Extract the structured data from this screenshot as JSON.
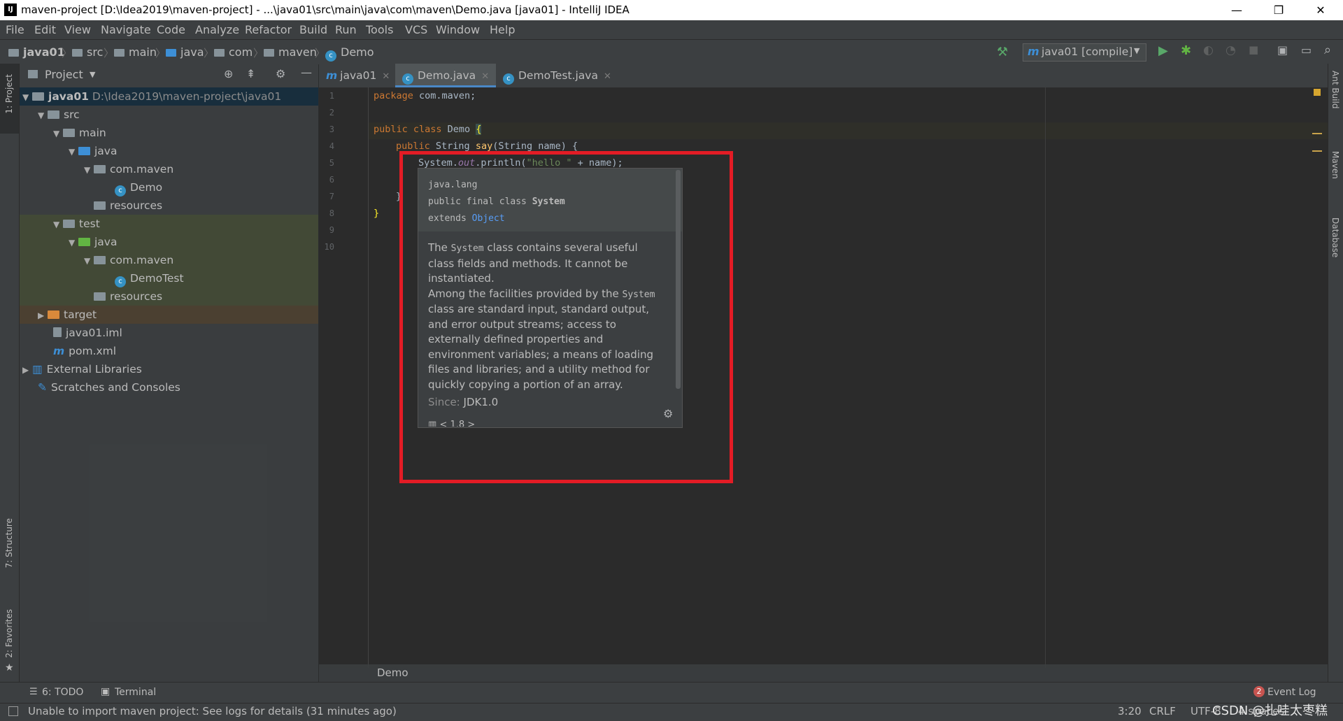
{
  "window": {
    "title": "maven-project [D:\\Idea2019\\maven-project] - ...\\java01\\src\\main\\java\\com\\maven\\Demo.java [java01] - IntelliJ IDEA",
    "minimize": "—",
    "maximize": "❐",
    "close": "✕"
  },
  "menu": [
    "File",
    "Edit",
    "View",
    "Navigate",
    "Code",
    "Analyze",
    "Refactor",
    "Build",
    "Run",
    "Tools",
    "VCS",
    "Window",
    "Help"
  ],
  "breadcrumbs": [
    "java01",
    "src",
    "main",
    "java",
    "com",
    "maven",
    "Demo"
  ],
  "run_config": "java01 [compile]",
  "left_stripe": {
    "project": "1: Project",
    "structure": "7: Structure",
    "favorites": "2: Favorites"
  },
  "right_stripe": {
    "ant": "Ant Build",
    "maven": "Maven",
    "database": "Database"
  },
  "project_panel": {
    "title": "Project",
    "tree": [
      {
        "label": "java01",
        "extra": "D:\\Idea2019\\maven-project\\java01"
      },
      {
        "label": "src"
      },
      {
        "label": "main"
      },
      {
        "label": "java"
      },
      {
        "label": "com.maven"
      },
      {
        "label": "Demo"
      },
      {
        "label": "resources"
      },
      {
        "label": "test"
      },
      {
        "label": "java"
      },
      {
        "label": "com.maven"
      },
      {
        "label": "DemoTest"
      },
      {
        "label": "resources"
      },
      {
        "label": "target"
      },
      {
        "label": "java01.iml"
      },
      {
        "label": "pom.xml"
      },
      {
        "label": "External Libraries"
      },
      {
        "label": "Scratches and Consoles"
      }
    ]
  },
  "tabs": [
    {
      "label": "java01"
    },
    {
      "label": "Demo.java"
    },
    {
      "label": "DemoTest.java"
    }
  ],
  "editor": {
    "line_numbers": [
      "1",
      "2",
      "3",
      "4",
      "5",
      "6",
      "7",
      "8",
      "9",
      "10"
    ],
    "line1_kw": "package",
    "line1_rest": " com.maven;",
    "line3_kw": "public class",
    "line3_rest": " Demo ",
    "line3_brace": "{",
    "line4_kw": "public",
    "line4_rest": " String ",
    "line4_fn": "say",
    "line4_tail": "(String name) {",
    "line5_a": "System.",
    "line5_b": "out",
    "line5_c": ".println(",
    "line5_str": "\"hello \"",
    "line5_d": " + name);",
    "line7": "}",
    "line8": "}",
    "bottom_breadcrumb": "Demo"
  },
  "doc_popup": {
    "package": "java.lang",
    "sig_prefix": "public final class ",
    "sig_class": "System",
    "extends_prefix": "extends ",
    "extends_class": "Object",
    "p1_a": "The ",
    "p1_code": "System",
    "p1_b": " class contains several useful class fields and methods. It cannot be instantiated.",
    "p2_a": "Among the facilities provided by the ",
    "p2_code": "System",
    "p2_b": " class are standard input, standard output, and error output streams; access to externally defined properties and environment variables; a means of loading files and libraries; and a utility method for quickly copying a portion of an array.",
    "since_label": "Since:",
    "since_value": "JDK1.0",
    "footer": "< 1.8 >"
  },
  "bottom_tools": {
    "todo": "6: TODO",
    "terminal": "Terminal",
    "event_log": "Event Log",
    "event_count": "2"
  },
  "status": {
    "message": "Unable to import maven project: See logs for details (31 minutes ago)",
    "position": "3:20",
    "line_sep": "CRLF",
    "encoding": "UTF-8",
    "indent": "4 spaces",
    "watermark": "CSDN @扎哇太枣糕"
  },
  "colors": {
    "accent": "#4a88c7",
    "highlight_box": "#e31c25",
    "run": "#59a869",
    "debug": "#62b543"
  }
}
